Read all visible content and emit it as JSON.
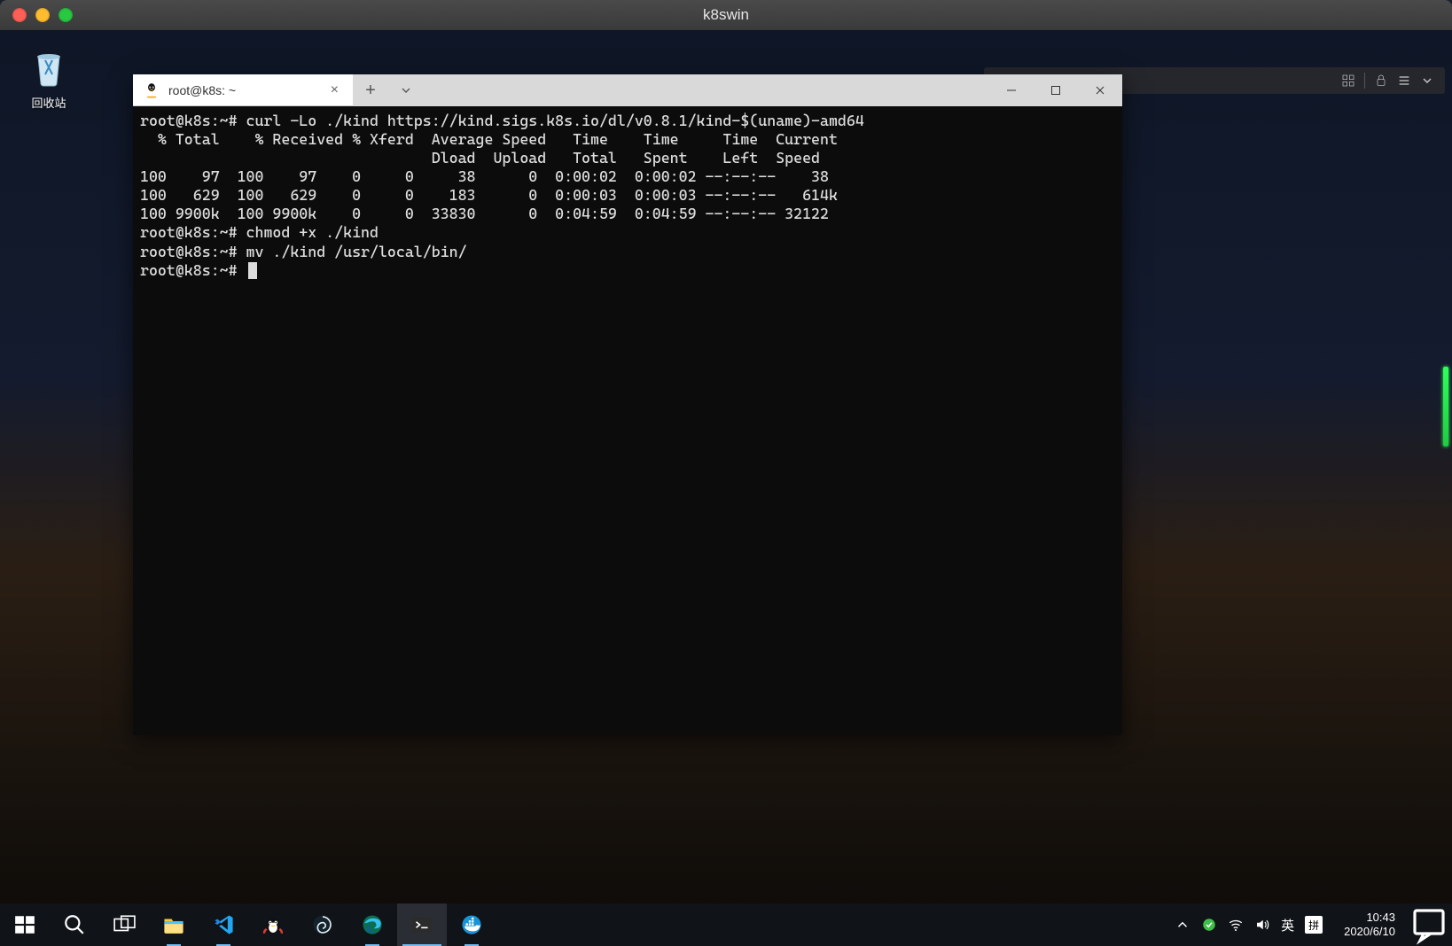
{
  "outer_window": {
    "title": "k8swin"
  },
  "desktop_icons": {
    "recycle_bin": "回收站"
  },
  "bg_toolbar": {
    "hint": ""
  },
  "terminal_window": {
    "tab": {
      "title": "root@k8s: ~"
    },
    "controls": {
      "new_tab": "+",
      "close_tab": "×"
    },
    "lines": [
      "root@k8s:~# curl -Lo ./kind https://kind.sigs.k8s.io/dl/v0.8.1/kind-$(uname)-amd64",
      "  % Total    % Received % Xferd  Average Speed   Time    Time     Time  Current",
      "                                 Dload  Upload   Total   Spent    Left  Speed",
      "100    97  100    97    0     0     38      0  0:00:02  0:00:02 --:--:--    38",
      "100   629  100   629    0     0    183      0  0:00:03  0:00:03 --:--:--   614k",
      "100 9900k  100 9900k    0     0  33830      0  0:04:59  0:04:59 --:--:-- 32122",
      "root@k8s:~# chmod +x ./kind",
      "root@k8s:~# mv ./kind /usr/local/bin/",
      "root@k8s:~# "
    ]
  },
  "taskbar": {
    "clock": {
      "time": "10:43",
      "date": "2020/6/10"
    },
    "lang1": "英",
    "lang2": "拼"
  }
}
